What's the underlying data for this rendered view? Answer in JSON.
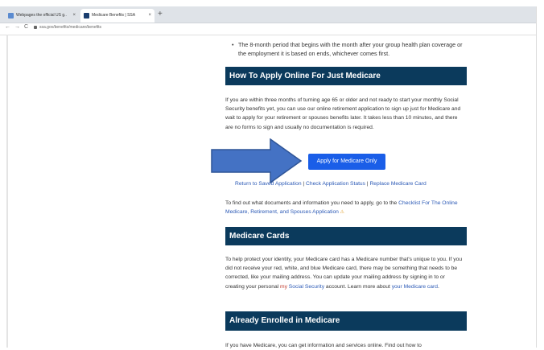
{
  "browser": {
    "tabs": [
      {
        "label": "Webpages the official US g.."
      },
      {
        "label": "Medicare Benefits | SSA"
      }
    ],
    "close_glyph": "×",
    "new_tab_glyph": "+",
    "nav": {
      "back": "←",
      "forward": "→",
      "reload": "C"
    },
    "url": "ssa.gov/benefits/medicare/benefits"
  },
  "page": {
    "bullet_text": "The 8-month period that begins with the month after your group health plan coverage or the employment it is based on ends, whichever comes first.",
    "sections": {
      "apply_online": {
        "title": "How To Apply Online For Just Medicare",
        "body": "If you are within three months of turning age 65 or older and not ready to start your monthly Social Security benefits yet, you can use our online retirement application to sign up just for Medicare and wait to apply for your retirement or spouses benefits later. It takes less than 10 minutes, and there are no forms to sign and usually no documentation is required.",
        "button": "Apply for Medicare Only",
        "links": [
          "Return to Saved Application",
          "Check Application Status",
          "Replace Medicare Card"
        ],
        "link_separator": " | ",
        "checklist_prefix": "To find out what documents and information you need to apply, go to the ",
        "checklist_link": "Checklist For The Online Medicare, Retirement, and Spouses Application"
      },
      "cards": {
        "title": "Medicare Cards",
        "body_1": "To help protect your identity, your Medicare card has a Medicare number that's unique to you. If you did not receive your red, white, and blue Medicare card, there may be something that needs to be corrected, like your mailing address. You can update your mailing address by signing in to or creating your personal ",
        "my_link": "my",
        "social_link": " Social Security",
        "body_2": " account. Learn more about ",
        "card_link": "your Medicare card",
        "body_3": "."
      },
      "enrolled": {
        "title": "Already Enrolled in Medicare",
        "body": "If you have Medicare, you can get information and services online. Find out how to"
      }
    }
  },
  "colors": {
    "section_bar": "#0b3a5c",
    "button": "#1a5ee8",
    "link": "#2c5ab6",
    "arrow": "#4472c4"
  }
}
